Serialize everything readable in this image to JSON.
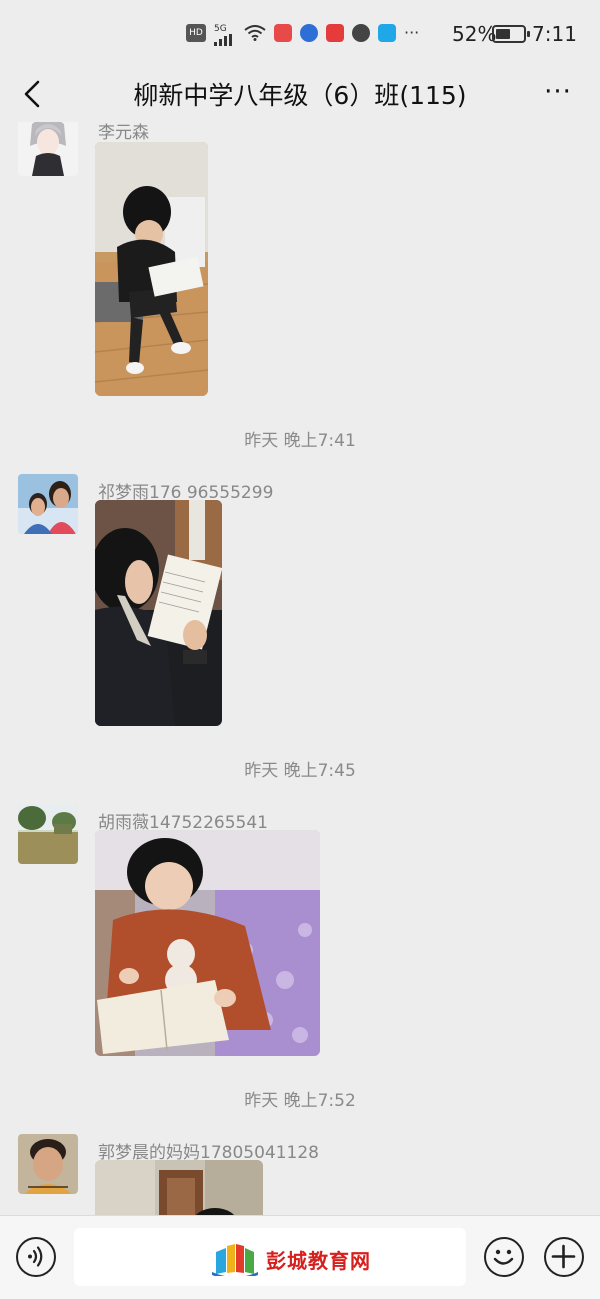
{
  "status_bar": {
    "signal_label": "5G",
    "hd_label": "HD",
    "more_dots": "···",
    "battery_percent": "52%",
    "battery_level": 0.52,
    "time": "7:11"
  },
  "header": {
    "title": "柳新中学八年级（6）班(115)",
    "more_label": "···"
  },
  "messages": [
    {
      "sender": "李元森"
    },
    {
      "time": "昨天 晚上7:41",
      "sender": "祁梦雨176 96555299"
    },
    {
      "time": "昨天 晚上7:45",
      "sender": "胡雨薇14752265541"
    },
    {
      "time": "昨天 晚上7:52",
      "sender": "郭梦晨的妈妈17805041128"
    }
  ],
  "bottom_bar": {
    "watermark_text": "彭城教育网"
  },
  "colors": {
    "background": "#ededed",
    "timestamp": "#8a8a8a",
    "sender": "#888888",
    "watermark_red": "#d6201e"
  }
}
